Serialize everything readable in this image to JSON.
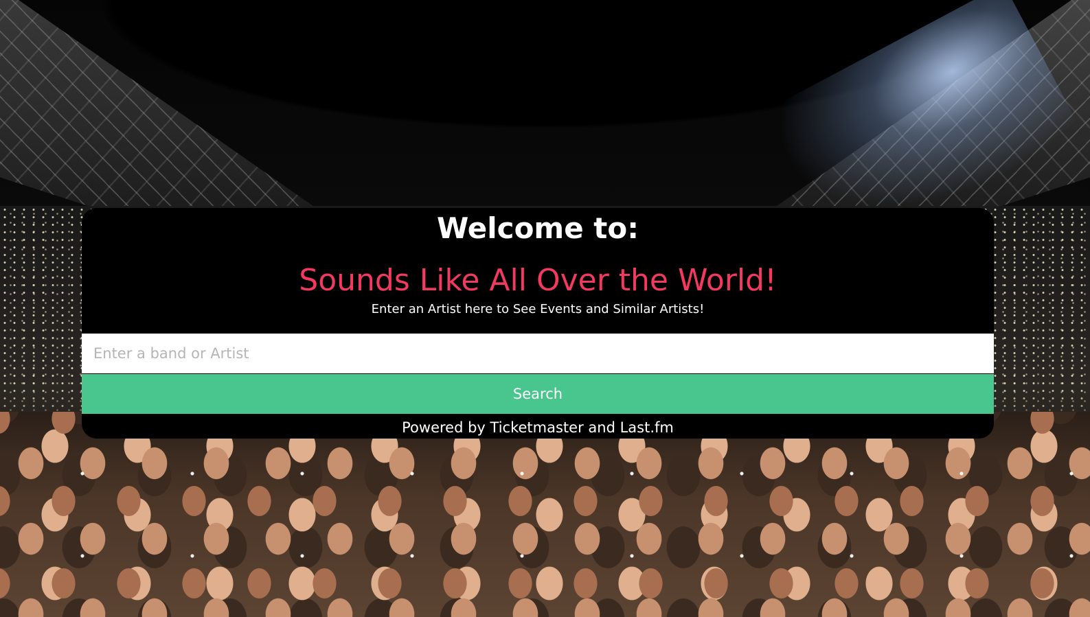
{
  "header": {
    "welcome": "Welcome to:",
    "title": "Sounds Like All Over the World!",
    "subtitle": "Enter an Artist here to See Events and Similar Artists!"
  },
  "search": {
    "placeholder": "Enter a band or Artist",
    "value": "",
    "button_label": "Search"
  },
  "footer": {
    "powered_by": "Powered by Ticketmaster and Last.fm"
  },
  "colors": {
    "accent_title": "#f2395f",
    "button": "#48c68e",
    "card_background": "#000000"
  }
}
